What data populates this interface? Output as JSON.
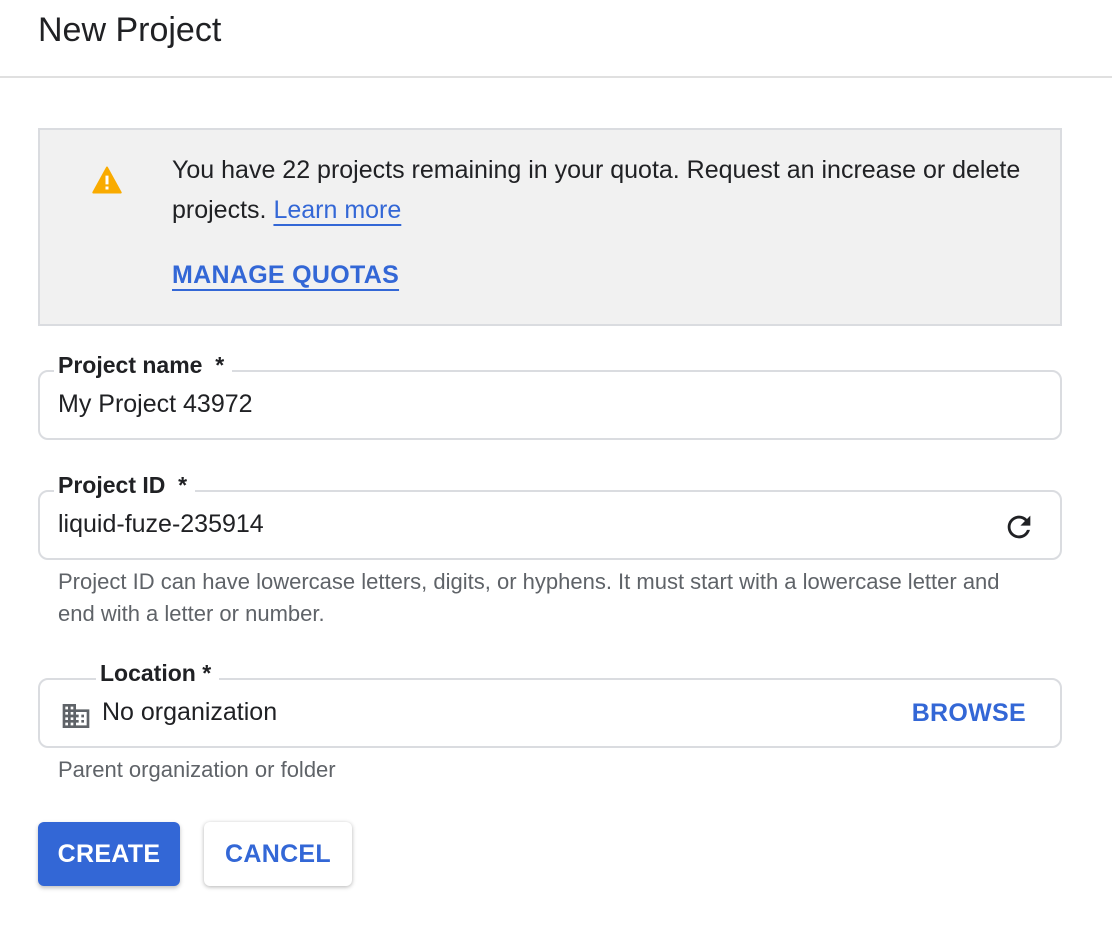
{
  "header": {
    "title": "New Project"
  },
  "notice": {
    "icon": "warning-icon",
    "message": "You have 22 projects remaining in your quota. Request an increase or delete projects.",
    "learn_more_label": "Learn more",
    "manage_quotas_label": "MANAGE QUOTAS"
  },
  "form": {
    "project_name": {
      "label": "Project name",
      "required_marker": "*",
      "value": "My Project 43972"
    },
    "project_id": {
      "label": "Project ID",
      "required_marker": "*",
      "value": "liquid-fuze-235914",
      "refresh_icon": "refresh-icon",
      "helper": "Project ID can have lowercase letters, digits, or hyphens. It must start with a lowercase letter and end with a letter or number."
    },
    "location": {
      "label": "Location",
      "required_marker": "*",
      "value": "No organization",
      "icon": "building-icon",
      "browse_label": "BROWSE",
      "helper": "Parent organization or folder"
    }
  },
  "actions": {
    "create_label": "CREATE",
    "cancel_label": "CANCEL"
  },
  "colors": {
    "accent": "#3367d6",
    "warning": "#f9ab00",
    "notice_bg": "#f1f1f1",
    "border": "#dadce0",
    "helper_text": "#5f6368"
  }
}
